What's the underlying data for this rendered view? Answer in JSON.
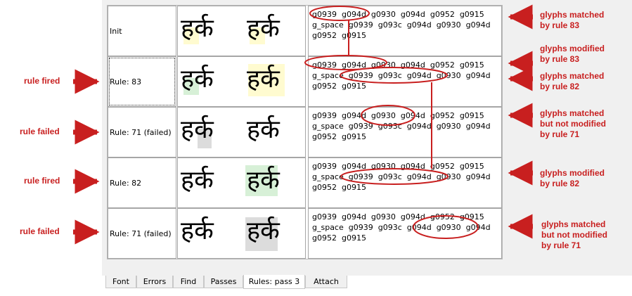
{
  "rows": [
    {
      "label": "Init",
      "lines": [
        "g0939  g094d  g0930  g094d  g0952  g0915",
        "g_space  g0939  g093c  g094d  g0930  g094d",
        "g0952  g0915"
      ],
      "left_callout": "",
      "right_callout": [
        "glyphs matched",
        "by rule 83"
      ]
    },
    {
      "label": "Rule: 83",
      "lines": [
        "g0939  g094d  g0930  g094d  g0952  g0915",
        "g_space  g0939  g093c  g094d  g0930  g094d",
        "g0952  g0915"
      ],
      "left_callout": "rule fired",
      "right_callout": [
        "glyphs modified",
        "by rule 83"
      ],
      "right_callout_b": [
        "glyphs matched",
        "by rule 82"
      ]
    },
    {
      "label": "Rule: 71 (failed)",
      "lines": [
        "g0939  g094d  g0930  g094d  g0952  g0915",
        "g_space  g0939  g093c  g094d  g0930  g094d",
        "g0952  g0915"
      ],
      "left_callout": "rule failed",
      "right_callout": [
        "glyphs matched",
        "but not modified",
        "by rule 71"
      ]
    },
    {
      "label": "Rule: 82",
      "lines": [
        "g0939  g094d  g0930  g094d  g0952  g0915",
        "g_space  g0939  g093c  g094d  g0930  g094d",
        "g0952  g0915"
      ],
      "left_callout": "rule fired",
      "right_callout": [
        "glyphs modified",
        "by rule 82"
      ]
    },
    {
      "label": "Rule: 71 (failed)",
      "lines": [
        "g0939  g094d  g0930  g094d  g0952  g0915",
        "g_space  g0939  g093c  g094d  g0930  g094d",
        "g0952  g0915"
      ],
      "left_callout": "rule failed",
      "right_callout": [
        "glyphs matched",
        "but not modified",
        "by rule 71"
      ]
    }
  ],
  "glyph_word": "हर्क",
  "tabs": [
    "Font",
    "Errors",
    "Find",
    "Passes",
    "Rules: pass 3",
    "Attach"
  ],
  "active_tab": "Rules: pass 3",
  "colors": {
    "annotation": "#c81f1f",
    "highlight_matched": "#fffbd0",
    "highlight_modified": "#d7f0d7",
    "highlight_not_modified": "#dcdcdc"
  }
}
